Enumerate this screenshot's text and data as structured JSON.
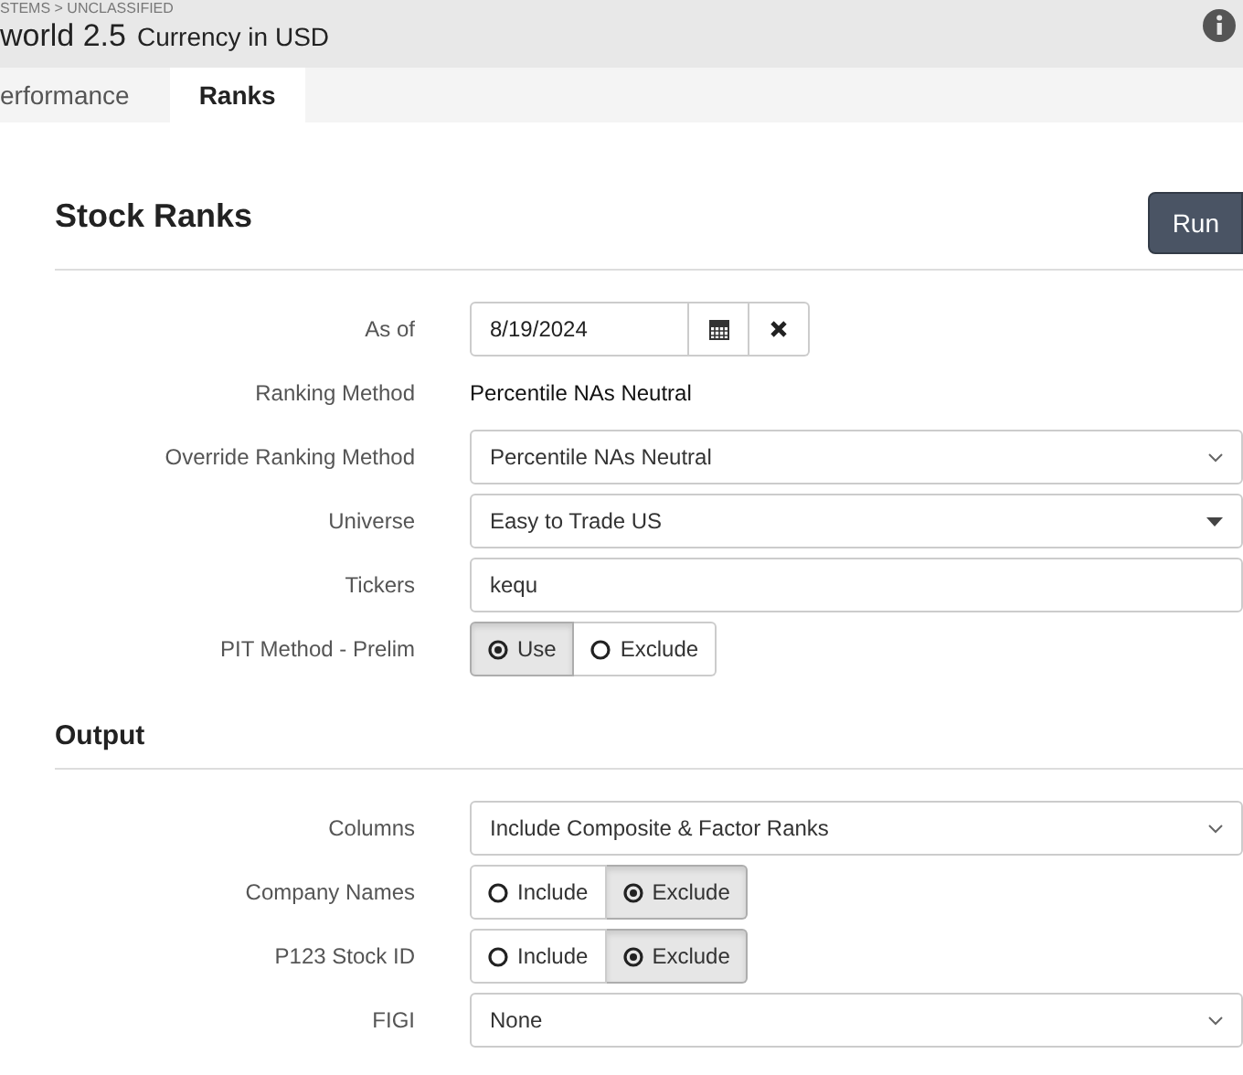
{
  "header": {
    "breadcrumb": "STEMS > UNCLASSIFIED",
    "title": "world 2.5",
    "subtitle": "Currency in USD"
  },
  "tabs": [
    {
      "label": "erformance",
      "selected": false
    },
    {
      "label": "Ranks",
      "selected": true
    }
  ],
  "page_title": "Stock Ranks",
  "run_button": "Run",
  "sections": [
    {
      "rows": [
        {
          "label": "As of",
          "kind": "date",
          "value": "8/19/2024"
        },
        {
          "label": "Ranking Method",
          "kind": "text",
          "value": "Percentile NAs Neutral"
        },
        {
          "label": "Override Ranking Method",
          "kind": "select",
          "value": "Percentile NAs Neutral"
        },
        {
          "label": "Universe",
          "kind": "dropdown",
          "value": "Easy to Trade US"
        },
        {
          "label": "Tickers",
          "kind": "input",
          "value": "kequ"
        },
        {
          "label": "PIT Method - Prelim",
          "kind": "toggle",
          "options": [
            {
              "label": "Use",
              "selected": true
            },
            {
              "label": "Exclude",
              "selected": false
            }
          ]
        }
      ]
    },
    {
      "title": "Output",
      "rows": [
        {
          "label": "Columns",
          "kind": "select",
          "value": "Include Composite & Factor Ranks"
        },
        {
          "label": "Company Names",
          "kind": "toggle",
          "options": [
            {
              "label": "Include",
              "selected": false
            },
            {
              "label": "Exclude",
              "selected": true
            }
          ]
        },
        {
          "label": "P123 Stock ID",
          "kind": "toggle",
          "options": [
            {
              "label": "Include",
              "selected": false
            },
            {
              "label": "Exclude",
              "selected": true
            }
          ]
        },
        {
          "label": "FIGI",
          "kind": "select",
          "value": "None"
        }
      ]
    }
  ]
}
